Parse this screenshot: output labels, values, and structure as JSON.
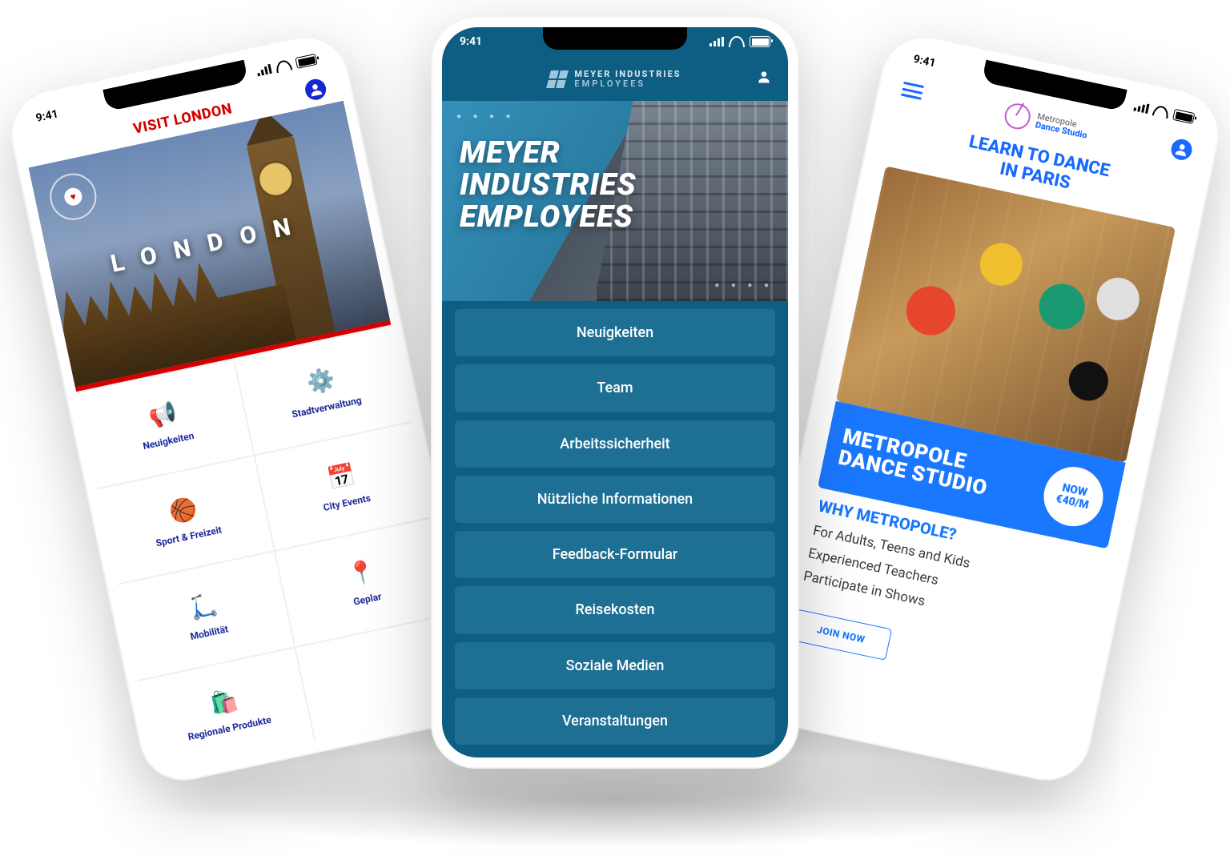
{
  "status_time": "9:41",
  "left": {
    "title": "VISIT LONDON",
    "hero_text": "LONDON",
    "tiles": [
      {
        "icon": "📢",
        "label": "Neuigkeiten"
      },
      {
        "icon": "⚙️",
        "label": "Stadtverwaltung"
      },
      {
        "icon": "🏀",
        "label": "Sport & Freizeit"
      },
      {
        "icon": "📅",
        "label": "City Events"
      },
      {
        "icon": "🛴",
        "label": "Mobilität"
      },
      {
        "icon": "📍",
        "label": "Geplar"
      },
      {
        "icon": "🛍️",
        "label": "Regionale Produkte"
      },
      {
        "icon": "",
        "label": ""
      }
    ]
  },
  "center": {
    "brand_line1": "MEYER INDUSTRIES",
    "brand_line2": "EMPLOYEES",
    "hero_l1": "MEYER",
    "hero_l2": "INDUSTRIES",
    "hero_l3": "EMPLOYEES",
    "menu": [
      "Neuigkeiten",
      "Team",
      "Arbeitssicherheit",
      "Nützliche Informationen",
      "Feedback-Formular",
      "Reisekosten",
      "Soziale Medien",
      "Veranstaltungen"
    ]
  },
  "right": {
    "brand_l1": "Metropole",
    "brand_l2": "Dance Studio",
    "tag_l1": "LEARN TO DANCE",
    "tag_l2": "IN PARIS",
    "band_l1": "METROPOLE",
    "band_l2": "DANCE STUDIO",
    "price_l1": "NOW",
    "price_l2": "€40/M",
    "why": "WHY METROPOLE?",
    "bullets": [
      "For Adults, Teens and Kids",
      "Experienced Teachers",
      "Participate in Shows"
    ],
    "join": "JOIN NOW"
  }
}
